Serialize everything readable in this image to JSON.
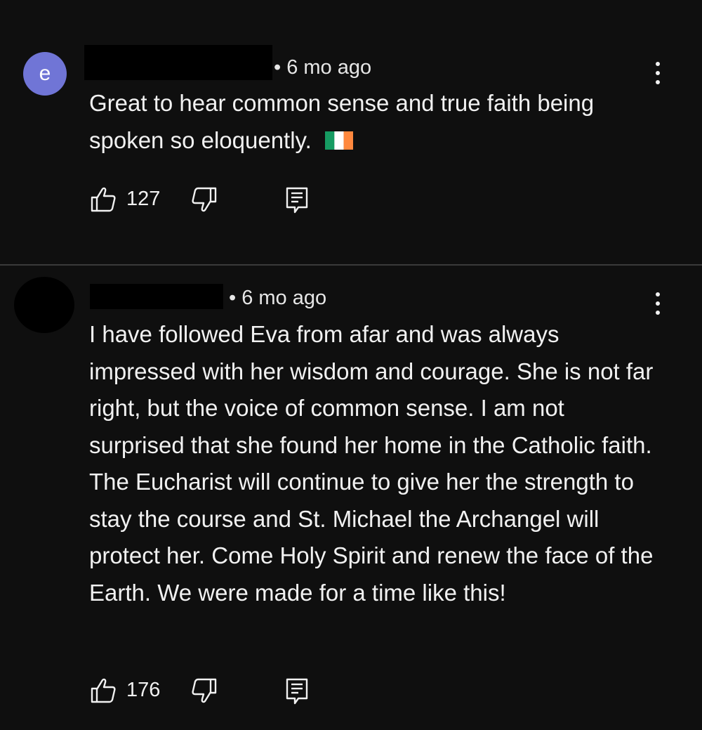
{
  "comments": [
    {
      "avatar_initial": "e",
      "avatar_color": "#7075d6",
      "time": "• 6 mo ago",
      "text": "Great to hear common sense and true faith being spoken so eloquently.",
      "emoji": "irish-flag",
      "likes": "127"
    },
    {
      "avatar_initial": "",
      "avatar_color": "#000000",
      "time": "• 6 mo ago",
      "text": "I have followed Eva from afar and was always impressed with her wisdom and courage. She is not far right, but the voice of common sense. I am not surprised that she found her home in the Catholic faith. The Eucharist will continue to give her the strength to stay the course and St. Michael the Archangel will protect her. Come Holy Spirit and renew the face of the Earth. We were made for a time like this!",
      "likes": "176"
    }
  ],
  "icons": {
    "like": "thumbs-up-icon",
    "dislike": "thumbs-down-icon",
    "reply": "reply-icon",
    "menu": "more-vert-icon"
  },
  "colors": {
    "background": "#0f0f0f",
    "text": "#f1f1f1",
    "divider": "#3a3a3a"
  }
}
